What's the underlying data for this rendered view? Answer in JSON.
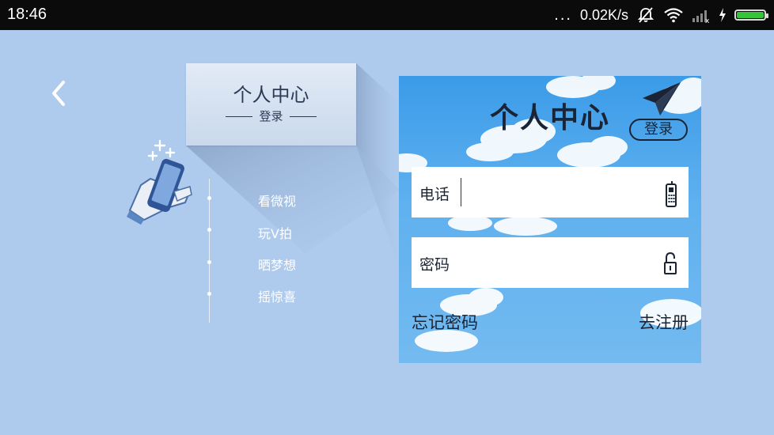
{
  "status_bar": {
    "time": "18:46",
    "dots": "...",
    "speed": "0.02K/s",
    "icons": [
      "silent-icon",
      "wifi-icon",
      "signal-icon",
      "charging-icon",
      "battery-icon"
    ],
    "battery_color": "#36c43b"
  },
  "left_panel": {
    "title": "个人中心",
    "subtitle": "登录",
    "menu": [
      {
        "label": "看微视"
      },
      {
        "label": "玩V拍"
      },
      {
        "label": "晒梦想"
      },
      {
        "label": "摇惊喜"
      }
    ]
  },
  "login_card": {
    "title": "个人中心",
    "login_button": "登录",
    "phone_field": {
      "label": "电话",
      "value": "",
      "icon": "mobile-phone-icon"
    },
    "password_field": {
      "label": "密码",
      "value": "",
      "icon": "unlock-icon"
    },
    "forgot_password": "忘记密码",
    "register": "去注册"
  },
  "colors": {
    "background": "#aecaec",
    "card_sky": "#3b9be8",
    "text_dark": "#1a2434"
  }
}
